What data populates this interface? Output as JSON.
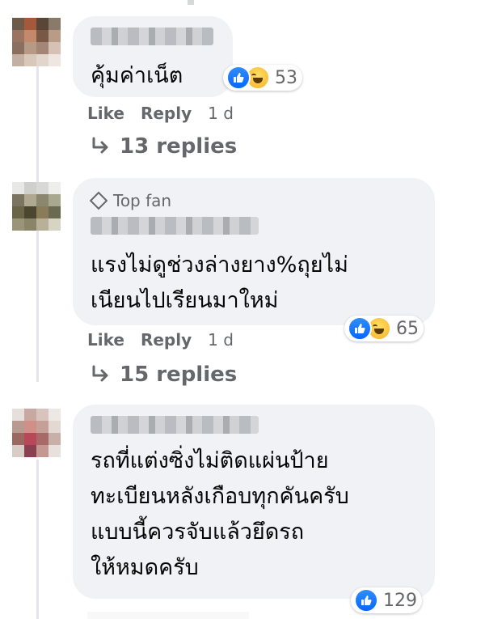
{
  "comments": [
    {
      "text": "คุ้มค่าเน็ต",
      "badge": "",
      "reaction_count": "53",
      "actions": {
        "like": "Like",
        "reply": "Reply",
        "time": "1 d"
      },
      "replies_label": "13 replies",
      "reaction_icons": [
        "like-icon",
        "haha-icon"
      ]
    },
    {
      "text": "แรงไม่ดูช่วงล่างยาง%ถุยไม่\nเนียนไปเรียนมาใหม่",
      "badge": "Top fan",
      "reaction_count": "65",
      "actions": {
        "like": "Like",
        "reply": "Reply",
        "time": "1 d"
      },
      "replies_label": "15 replies",
      "reaction_icons": [
        "like-icon",
        "haha-icon"
      ]
    },
    {
      "text": "รถที่แต่งซิ่งไม่ติดแผ่นป้าย\nทะเบียนหลังเกือบทุกคันครับ\nแบบนี้ควรจับแล้วยึดรถ\nให้หมดครับ",
      "badge": "",
      "reaction_count": "129",
      "reaction_icons": [
        "like-icon"
      ]
    }
  ],
  "colors": {
    "bubble": "#f0f2f5",
    "secondary_text": "#65676b",
    "like_blue": "#0866ff",
    "haha_yellow": "#f7b125"
  }
}
